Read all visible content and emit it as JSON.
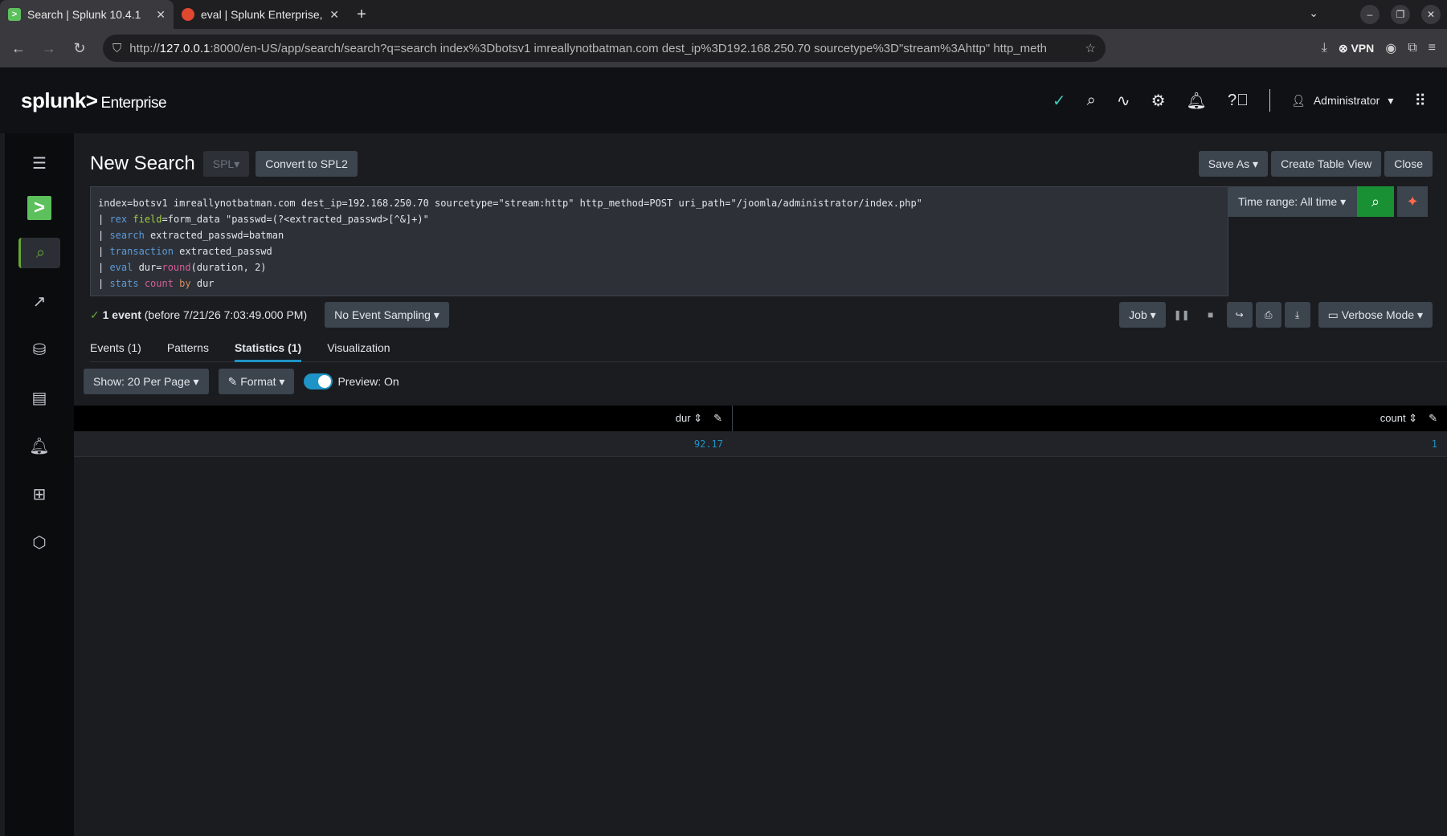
{
  "browser": {
    "tabs": [
      {
        "title": "Search | Splunk 10.4.1",
        "active": true
      },
      {
        "title": "eval | Splunk Enterprise, S",
        "active": false
      }
    ],
    "url_prefix": "http://",
    "url_host": "127.0.0.1",
    "url_rest": ":8000/en-US/app/search/search?q=search index%3Dbotsv1 imreallynotbatman.com dest_ip%3D192.168.250.70 sourcetype%3D\"stream%3Ahttp\" http_meth",
    "vpn_label": "VPN"
  },
  "header": {
    "logo": "splunk>",
    "product": "Enterprise",
    "user": "Administrator"
  },
  "page": {
    "title": "New Search",
    "spl_label": "SPL",
    "convert_label": "Convert to SPL2",
    "save_as": "Save As",
    "create_table_view": "Create Table View",
    "close": "Close"
  },
  "search": {
    "line1": "index=botsv1 imreallynotbatman.com dest_ip=192.168.250.70 sourcetype=\"stream:http\" http_method=POST uri_path=\"/joomla/administrator/index.php\"",
    "line2_cmd": "rex",
    "line2_arg": "field",
    "line2_rest": "=form_data \"passwd=(?<extracted_passwd>[^&]+)\"",
    "line3_cmd": "search",
    "line3_rest": " extracted_passwd=batman",
    "line4_cmd": "transaction",
    "line4_rest": " extracted_passwd",
    "line5_cmd": "eval",
    "line5_pre": " dur=",
    "line5_fn": "round",
    "line5_rest": "(duration, 2)",
    "line6_cmd": "stats",
    "line6_fn": "count",
    "line6_by": "by",
    "line6_rest": " dur",
    "time_range": "Time range: All time"
  },
  "status": {
    "event_count": "1 event",
    "event_detail": "(before 7/21/26 7:03:49.000 PM)",
    "sampling": "No Event Sampling",
    "job": "Job",
    "mode": "Verbose Mode"
  },
  "tabs": {
    "events": "Events (1)",
    "patterns": "Patterns",
    "statistics": "Statistics (1)",
    "visualization": "Visualization"
  },
  "options": {
    "show": "Show: 20 Per Page",
    "format": "Format",
    "preview": "Preview: On"
  },
  "table": {
    "columns": [
      "dur",
      "count"
    ],
    "rows": [
      [
        "92.17",
        "1"
      ]
    ]
  }
}
